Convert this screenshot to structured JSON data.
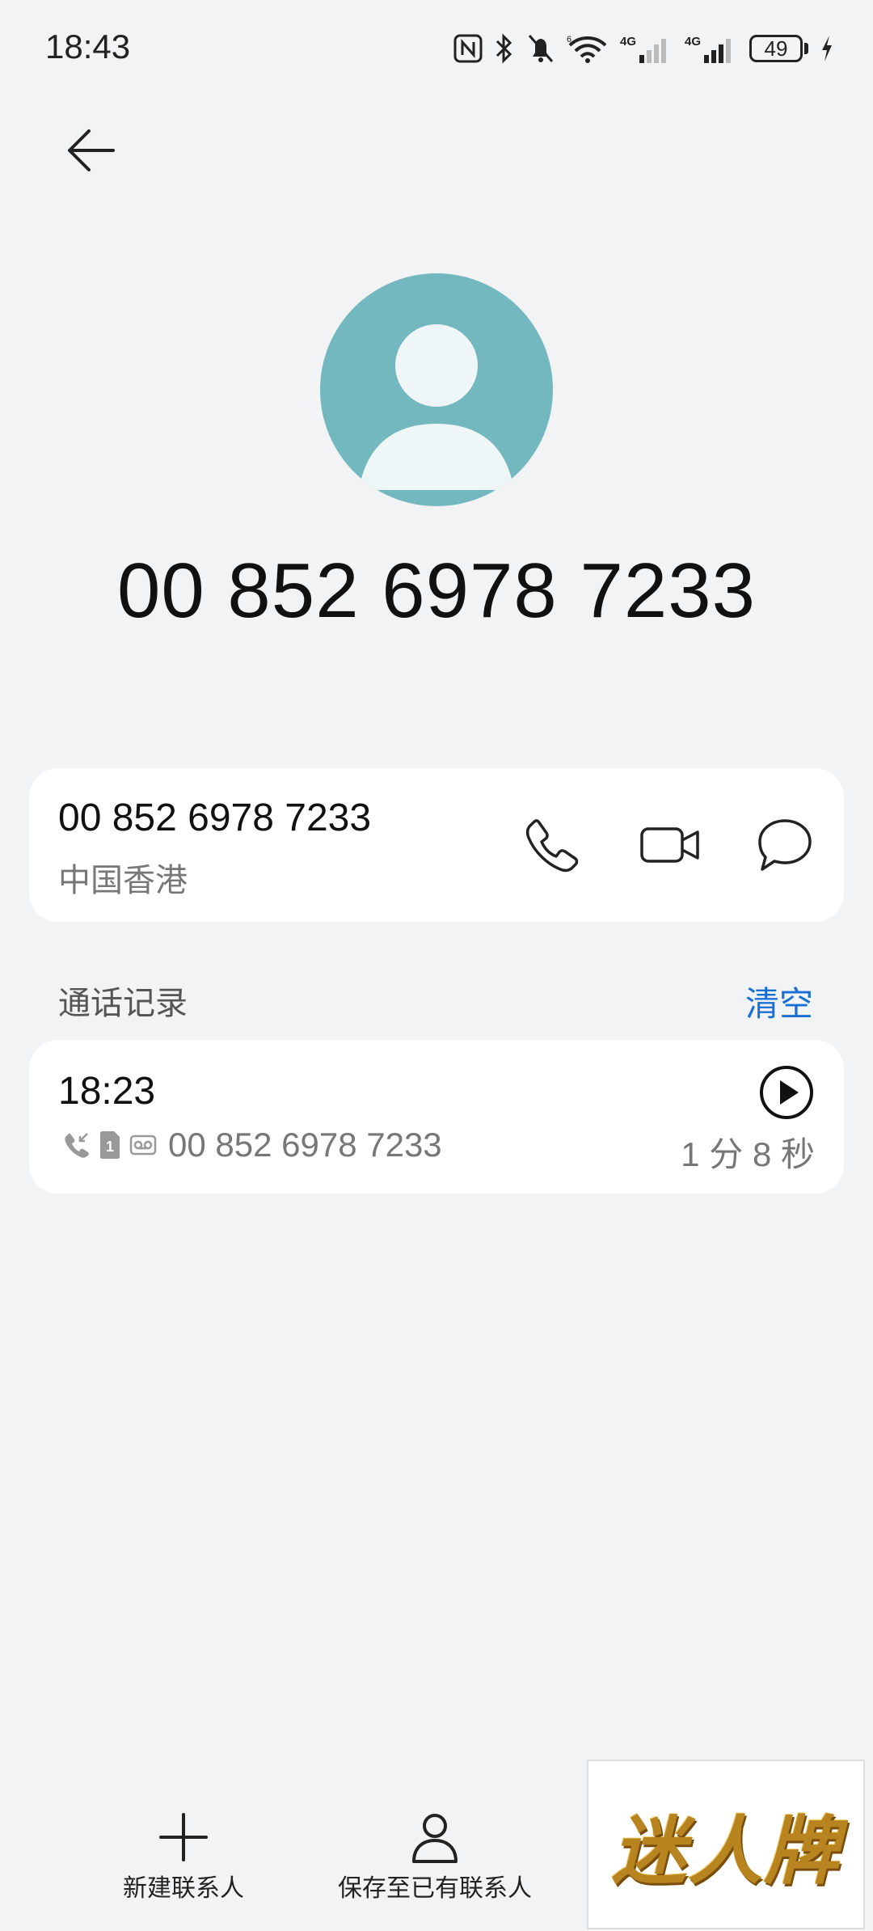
{
  "status_bar": {
    "time": "18:43",
    "battery": "49"
  },
  "contact": {
    "display_number": "00 852 6978 7233"
  },
  "number_card": {
    "number": "00 852 6978 7233",
    "region": "中国香港"
  },
  "call_log": {
    "header": "通话记录",
    "clear_label": "清空",
    "entries": [
      {
        "time": "18:23",
        "number": "00 852 6978 7233",
        "duration": "1 分 8 秒"
      }
    ]
  },
  "bottom_bar": {
    "new_contact": "新建联系人",
    "save_existing": "保存至已有联系人"
  },
  "ad": {
    "text": "迷人牌"
  },
  "colors": {
    "accent": "#1a6fd6",
    "avatar": "#74b8bf",
    "background": "#f1f3f5"
  }
}
